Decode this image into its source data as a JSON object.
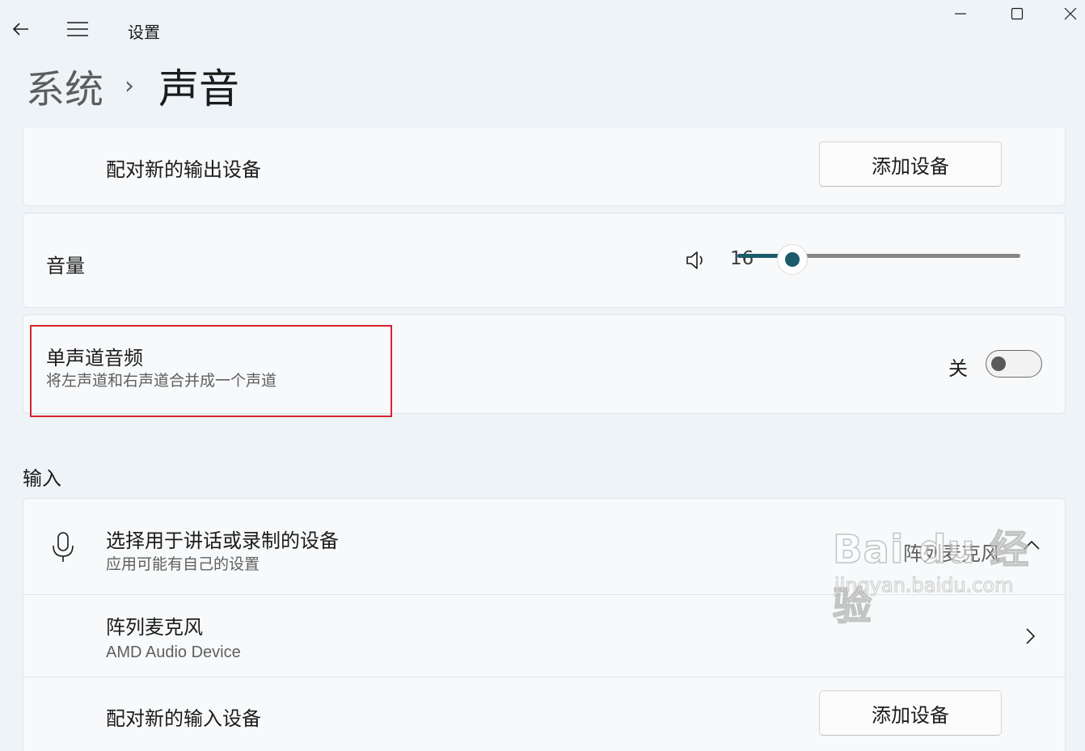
{
  "app": {
    "title": "设置"
  },
  "breadcrumb": {
    "parent": "系统",
    "separator": "›",
    "current": "声音"
  },
  "output": {
    "pair_device": {
      "label": "配对新的输出设备",
      "button": "添加设备"
    },
    "volume": {
      "label": "音量",
      "value": "16",
      "level_percent": 16,
      "icon": "speaker-icon"
    },
    "mono_audio": {
      "title": "单声道音频",
      "description": "将左声道和右声道合并成一个声道",
      "state_label": "关",
      "enabled": false
    }
  },
  "input": {
    "section_title": "输入",
    "choose_device": {
      "title": "选择用于讲话或录制的设备",
      "description": "应用可能有自己的设置",
      "selected": "阵列麦克风",
      "icon": "microphone-icon"
    },
    "device": {
      "name": "阵列麦克风",
      "detail": "AMD Audio Device"
    },
    "pair_device": {
      "label": "配对新的输入设备",
      "button": "添加设备"
    }
  },
  "watermark": {
    "brand": "Bai du 经验",
    "url": "jingyan.baidu.com"
  },
  "colors": {
    "accent": "#1c5b6b",
    "highlight": "#d9232d",
    "background": "#eef3f7"
  }
}
